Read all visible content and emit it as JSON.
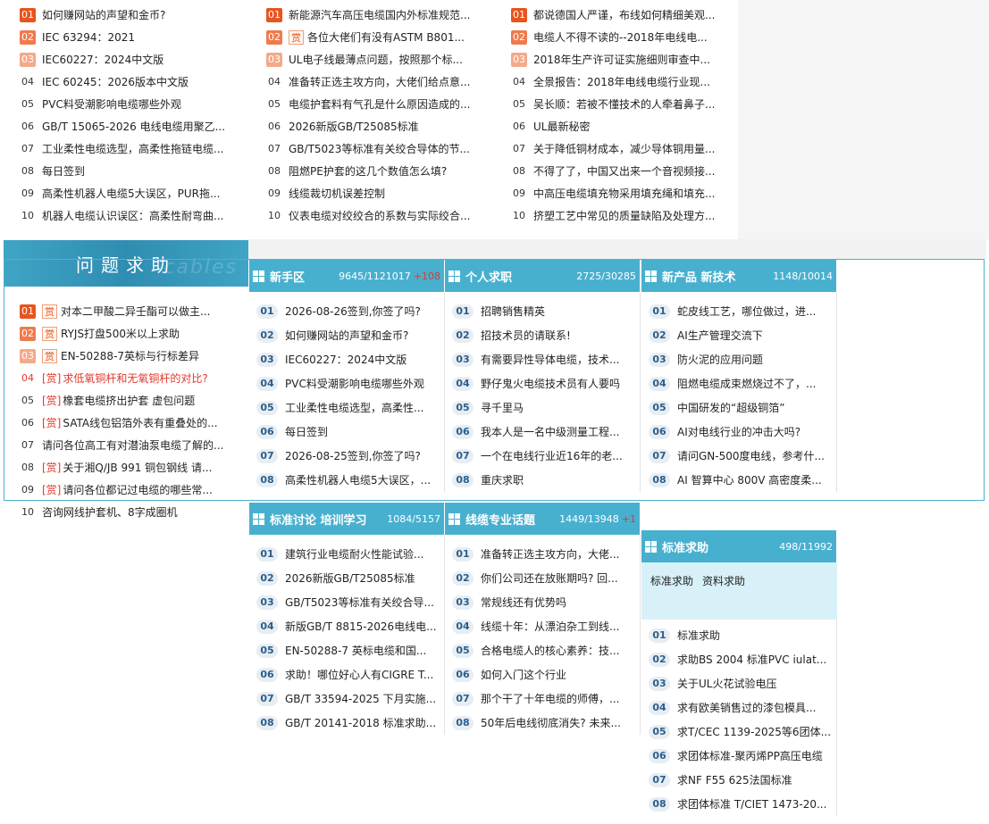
{
  "top_lists": [
    {
      "items": [
        {
          "rank": "01",
          "text": "如何赚网站的声望和金币?"
        },
        {
          "rank": "02",
          "text": "IEC 63294：2021"
        },
        {
          "rank": "03",
          "text": "IEC60227：2024中文版"
        },
        {
          "rank": "04",
          "text": "IEC 60245：2026版本中文版"
        },
        {
          "rank": "05",
          "text": "PVC料受潮影响电缆哪些外观"
        },
        {
          "rank": "06",
          "text": "GB/T 15065-2026 电线电缆用聚乙..."
        },
        {
          "rank": "07",
          "text": "工业柔性电缆选型，高柔性拖链电缆..."
        },
        {
          "rank": "08",
          "text": "每日签到"
        },
        {
          "rank": "09",
          "text": "高柔性机器人电缆5大误区，PUR拖..."
        },
        {
          "rank": "10",
          "text": "机器人电缆认识误区：高柔性耐弯曲..."
        }
      ]
    },
    {
      "items": [
        {
          "rank": "01",
          "text": "新能源汽车高压电缆国内外标准规范..."
        },
        {
          "rank": "02",
          "text": "各位大佬们有没有ASTM B801...",
          "tag": "赏"
        },
        {
          "rank": "03",
          "text": "UL电子线最薄点问题，按照那个标..."
        },
        {
          "rank": "04",
          "text": "准备转正选主攻方向，大佬们给点意..."
        },
        {
          "rank": "05",
          "text": "电缆护套料有气孔是什么原因造成的..."
        },
        {
          "rank": "06",
          "text": "2026新版GB/T25085标准"
        },
        {
          "rank": "07",
          "text": "GB/T5023等标准有关绞合导体的节..."
        },
        {
          "rank": "08",
          "text": "阻燃PE护套的这几个数值怎么填?"
        },
        {
          "rank": "09",
          "text": "线缆裁切机误差控制"
        },
        {
          "rank": "10",
          "text": "仪表电缆对绞绞合的系数与实际绞合..."
        }
      ]
    },
    {
      "items": [
        {
          "rank": "01",
          "text": "都说德国人严谨，布线如何精细美观..."
        },
        {
          "rank": "02",
          "text": "电缆人不得不读的--2018年电线电..."
        },
        {
          "rank": "03",
          "text": "2018年生产许可证实施细则审查中..."
        },
        {
          "rank": "04",
          "text": "全景报告：2018年电线电缆行业现..."
        },
        {
          "rank": "05",
          "text": "吴长顺：若被不懂技术的人牵着鼻子..."
        },
        {
          "rank": "06",
          "text": "UL最新秘密"
        },
        {
          "rank": "07",
          "text": "关于降低铜材成本，减少导体铜用量..."
        },
        {
          "rank": "08",
          "text": "不得了了，中国又出来一个音视频接..."
        },
        {
          "rank": "09",
          "text": "中高压电缆填充物采用填充绳和填充..."
        },
        {
          "rank": "10",
          "text": "挤塑工艺中常见的质量缺陷及处理方..."
        }
      ]
    }
  ],
  "help": {
    "title": "问题求助",
    "watermark": "cables",
    "items": [
      {
        "rank": "01",
        "text": "对本二甲酸二异壬酯可以做主...",
        "tag": "赏",
        "style": "box"
      },
      {
        "rank": "02",
        "text": "RYJS打盘500米以上求助",
        "tag": "赏",
        "style": "box"
      },
      {
        "rank": "03",
        "text": "EN-50288-7英标与行标差异",
        "tag": "赏",
        "style": "box"
      },
      {
        "rank": "04",
        "text": "求低氧铜杆和无氧铜杆的对比?",
        "tag": "[赏]",
        "style": "red"
      },
      {
        "rank": "05",
        "text": "橡套电缆挤出护套 虚包问题",
        "tag": "[赏]",
        "style": "bracket"
      },
      {
        "rank": "06",
        "text": "SATA线包铝箔外表有重叠处的...",
        "tag": "[赏]",
        "style": "bracket"
      },
      {
        "rank": "07",
        "text": "请问各位高工有对潜油泵电缆了解的..."
      },
      {
        "rank": "08",
        "text": "关于湘Q/JB 991 铜包钢线 请...",
        "tag": "[赏]",
        "style": "bracket"
      },
      {
        "rank": "09",
        "text": "请问各位都记过电缆的哪些常...",
        "tag": "[赏]",
        "style": "bracket"
      },
      {
        "rank": "10",
        "text": "咨询网线护套机、8字成圈机"
      }
    ]
  },
  "forums": [
    {
      "name": "新手区",
      "stats": "9645/1121017",
      "new": "+108",
      "items": [
        "2026-08-26签到,你签了吗?",
        "如何赚网站的声望和金币?",
        "IEC60227：2024中文版",
        "PVC料受潮影响电缆哪些外观",
        "工业柔性电缆选型，高柔性...",
        "每日签到",
        "2026-08-25签到,你签了吗?",
        "高柔性机器人电缆5大误区，..."
      ]
    },
    {
      "name": "个人求职",
      "stats": "2725/30285",
      "new": "",
      "items": [
        "招聘销售精英",
        "招技术员的请联系!",
        "有需要异性导体电缆，技术...",
        "野仔鬼火电缆技术员有人要吗",
        "寻千里马",
        "我本人是一名中级测量工程...",
        "一个在电线行业近16年的老...",
        "重庆求职"
      ]
    },
    {
      "name": "新产品 新技术",
      "stats": "1148/10014",
      "new": "",
      "items": [
        "蛇皮线工艺，哪位做过，进...",
        "AI生产管理交流下",
        "防火泥的应用问题",
        "阻燃电缆成束燃烧过不了，...",
        "中国研发的“超级铜箔”",
        "AI对电线行业的冲击大吗?",
        "请问GN-500度电线，参考什...",
        "AI 智算中心 800V 高密度柔..."
      ]
    },
    {
      "name": "标准讨论 培训学习",
      "stats": "1084/5157",
      "new": "",
      "items": [
        "建筑行业电缆耐火性能试验...",
        "2026新版GB/T25085标准",
        "GB/T5023等标准有关绞合导...",
        "新版GB/T 8815-2026电线电...",
        "EN-50288-7 英标电缆和国...",
        "求助！哪位好心人有CIGRE T...",
        "GB/T 33594-2025 下月实施...",
        "GB/T 20141-2018 标准求助..."
      ]
    },
    {
      "name": "线缆专业话题",
      "stats": "1449/13948",
      "new": "+1",
      "items": [
        "准备转正选主攻方向，大佬...",
        "你们公司还在放账期吗? 回...",
        "常规线还有优势吗",
        "线缆十年：从漂泊杂工到线...",
        "合格电缆人的核心素养：技...",
        "如何入门这个行业",
        "那个干了十年电缆的师傅，...",
        "50年后电线彻底消失? 未来..."
      ]
    },
    {
      "name": "标准求助",
      "stats": "498/11992",
      "new": "",
      "tags": [
        "标准求助",
        "资料求助"
      ],
      "items": [
        "标准求助",
        "求助BS 2004 标准PVC iulat...",
        "关于UL火花试验电压",
        "求有欧美销售过的漆包模具...",
        "求T/CEC 1139-2025等6团体...",
        "求团体标准-聚丙烯PP高压电缆",
        "求NF F55 625法国标准",
        "求团体标准 T/CIET 1473-20..."
      ]
    }
  ],
  "numbers": [
    "01",
    "02",
    "03",
    "04",
    "05",
    "06",
    "07",
    "08"
  ]
}
